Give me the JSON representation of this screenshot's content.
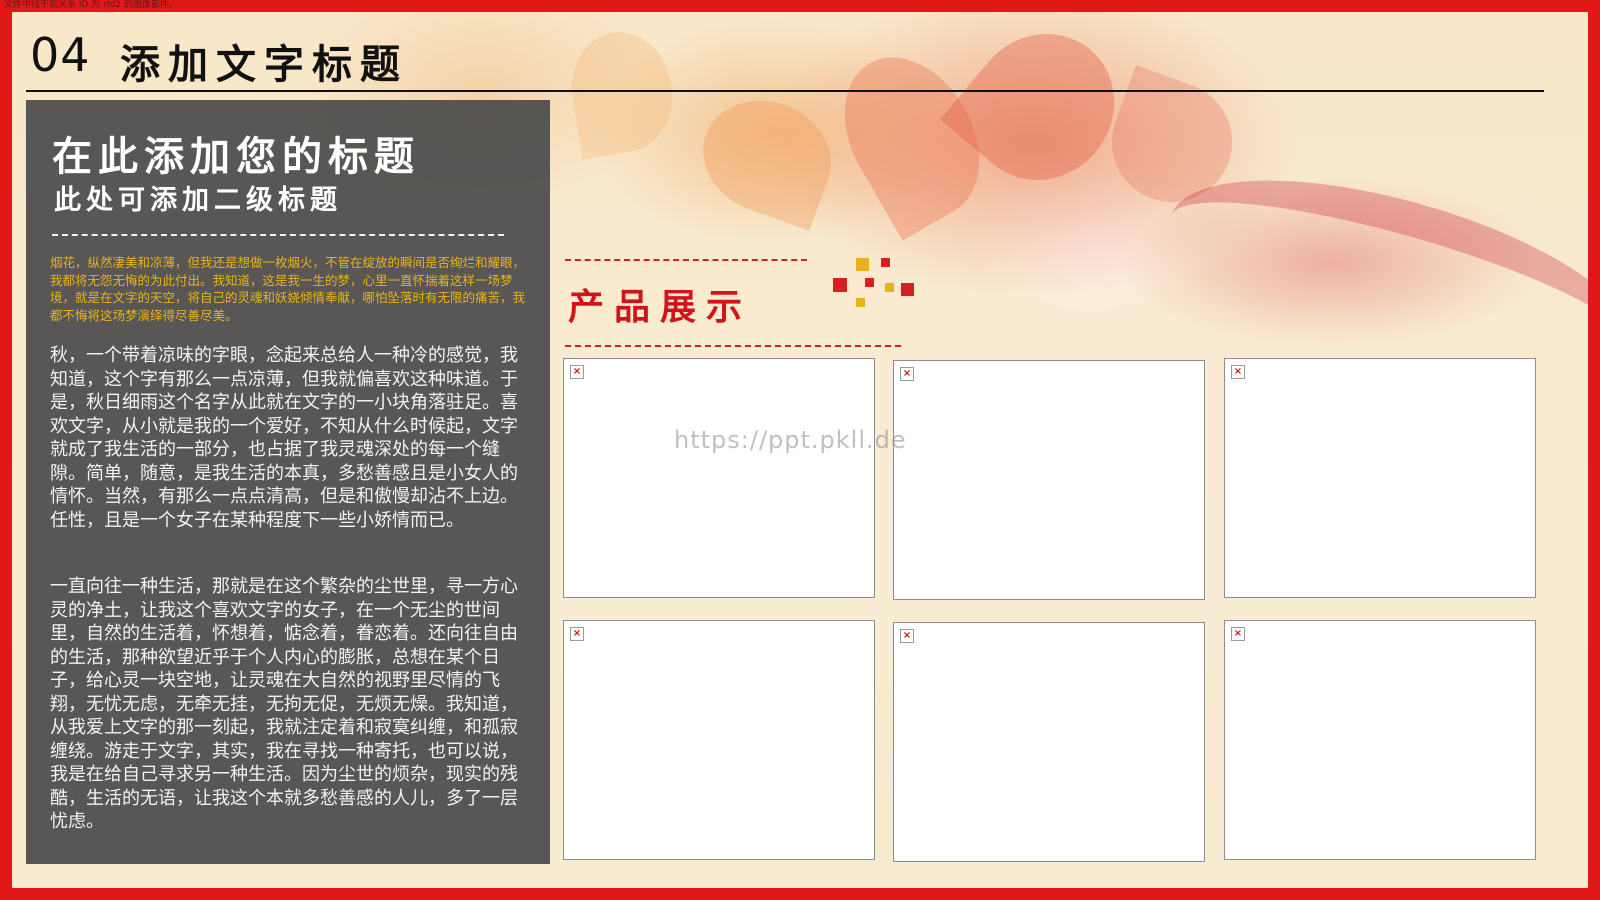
{
  "error_message": "文件中找不到关系 ID 为 rId2 的图像部件。",
  "header": {
    "number": "04",
    "title": "添加文字标题"
  },
  "panel": {
    "title": "在此添加您的标题",
    "subtitle": "此处可添加二级标题",
    "intro": "烟花，纵然凄美和凉薄，但我还是想做一枚烟火，不管在绽放的瞬间是否绚烂和耀眼，我都将无怨无悔的为此付出。我知道，这是我一生的梦，心里一直怀揣着这样一场梦境，就是在文字的天空，将自己的灵魂和妖娆倾情奉献，哪怕坠落时有无限的痛苦，我都不悔将这场梦演绎得尽善尽美。",
    "paragraph1": "秋，一个带着凉味的字眼，念起来总给人一种冷的感觉，我知道，这个字有那么一点凉薄，但我就偏喜欢这种味道。于是，秋日细雨这个名字从此就在文字的一小块角落驻足。喜欢文字，从小就是我的一个爱好，不知从什么时候起，文字就成了我生活的一部分，也占据了我灵魂深处的每一个缝隙。简单，随意，是我生活的本真，多愁善感且是小女人的情怀。当然，有那么一点点清高，但是和傲慢却沾不上边。任性，且是一个女子在某种程度下一些小娇情而已。",
    "paragraph2": "一直向往一种生活，那就是在这个繁杂的尘世里，寻一方心灵的净土，让我这个喜欢文字的女子，在一个无尘的世间里，自然的生活着，怀想着，惦念着，眷恋着。还向往自由的生活，那种欲望近乎于个人内心的膨胀，总想在某个日子，给心灵一块空地，让灵魂在大自然的视野里尽情的飞翔，无忧无虑，无牵无挂，无拘无促，无烦无燥。我知道，从我爱上文字的那一刻起，我就注定着和寂寞纠缠，和孤寂缠绕。游走于文字，其实，我在寻找一种寄托，也可以说，我是在给自己寻求另一种生活。因为尘世的烦杂，现实的残酷，生活的无语，让我这个本就多愁善感的人儿，多了一层忧虑。"
  },
  "section": {
    "title": "产品展示"
  },
  "watermark": "https://ppt.pkll.de",
  "images": [
    {
      "icon": "broken-image-icon"
    },
    {
      "icon": "broken-image-icon"
    },
    {
      "icon": "broken-image-icon"
    },
    {
      "icon": "broken-image-icon"
    },
    {
      "icon": "broken-image-icon"
    },
    {
      "icon": "broken-image-icon"
    }
  ],
  "colors": {
    "frame": "#e01818",
    "panel": "#4b4b4b",
    "accent_red": "#d0141a",
    "accent_gold": "#e9b21c"
  }
}
